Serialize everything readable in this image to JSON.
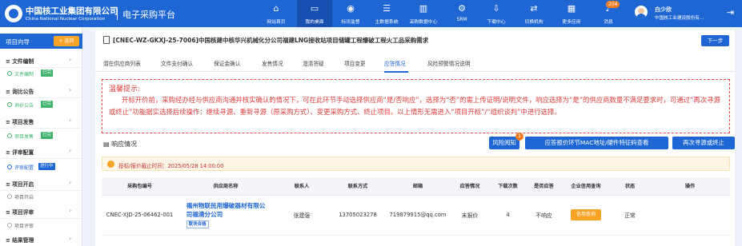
{
  "header": {
    "brand_cn": "中国核工业集团有限公司",
    "brand_en": "China National Nuclear Corporation",
    "platform": "电子采购平台",
    "nav": [
      {
        "label": "网站首页",
        "icon": "home-icon"
      },
      {
        "label": "我的桌面",
        "icon": "desktop-icon"
      },
      {
        "label": "标讯监督",
        "icon": "eye-icon"
      },
      {
        "label": "主数据系统",
        "icon": "database-icon"
      },
      {
        "label": "采购数据中心",
        "icon": "chart-icon"
      },
      {
        "label": "SRM",
        "icon": "gear-icon"
      },
      {
        "label": "下载中心",
        "icon": "download-icon"
      },
      {
        "label": "切换机构",
        "icon": "switch-icon"
      },
      {
        "label": "更多应用",
        "icon": "grid-icon"
      },
      {
        "label": "消息",
        "icon": "bell-icon"
      }
    ],
    "badge": "204",
    "user_name": "白少欣",
    "user_org": "中国核工业建设股份有…"
  },
  "sidebar": {
    "title": "项目向导",
    "back": "返回",
    "groups": [
      "文件编制",
      "询比公告",
      "项目发售",
      "评审配置",
      "项目开启",
      "项目评审",
      "结果管理"
    ],
    "subs": [
      {
        "label": "文件编制",
        "tag": "已完"
      },
      {
        "label": "询价公告",
        "tag": "已完"
      },
      {
        "label": "项目发售",
        "tag": "已完"
      },
      {
        "label": "评审配置",
        "tag": "进行中"
      },
      {
        "label": "项目开启",
        "tag": ""
      },
      {
        "label": "项目评审",
        "tag": ""
      }
    ]
  },
  "main": {
    "title": "[CNEC-WZ-GKXJ-25-7006]中国核建中核华兴机械化分公司福建LNG接收站项目储罐工程爆破工程火工品采购需求",
    "next": "下一步",
    "tabs": [
      "潜在供应商列表",
      "文件支付确认",
      "保证金确认",
      "发售情况",
      "澄清答疑",
      "项目变更",
      "应答情况",
      "风险预警情况说明"
    ],
    "tip_title": "温馨提示:",
    "tip_body": "开标开价前，采购经办经与供应商沟通并核实确认的情况下，可在此环节手动选择供应商“是/否响应”，选择为“否”的需上传证明/说明文件，响应选择为“是”的供应商数量不满足要求时，可通过“再次寻源或终止”功能据实选择后续操作：继续寻源、重新寻源（原采购方式）、变更采购方式、终止项目。以上情形无需进入“项目开标”/“组织谈判”中进行选择。",
    "response_title": "响应情况",
    "buttons": {
      "risk": "风险阅知",
      "risk_count": "1",
      "mac": "应答报价环节MAC地址/硬件特征码查看",
      "resource": "再次寻源或终止"
    },
    "deadline": "投标/报价截止时间：2025/05/28 14:00:00",
    "table": {
      "headers": [
        "采购包编号",
        "供应商名称",
        "联系人",
        "联系方式",
        "邮箱",
        "应答情况",
        "下载次数",
        "是否应答",
        "企业信用查询",
        "状态",
        "操作"
      ],
      "rows": [
        {
          "pkg": "CNEC-XJD-25-06462-001",
          "supplier_l1": "福州物联民用爆破器材有限公",
          "supplier_l2": "司福清分公司",
          "supplier_tag": "联块合格",
          "contact": "张建强",
          "phone": "13705023278",
          "email": "719879915@qq.com",
          "response": "未报价",
          "downloads": "4",
          "answered": "不响应",
          "credit": "信用查询",
          "status": "正常",
          "op": ""
        }
      ]
    }
  }
}
